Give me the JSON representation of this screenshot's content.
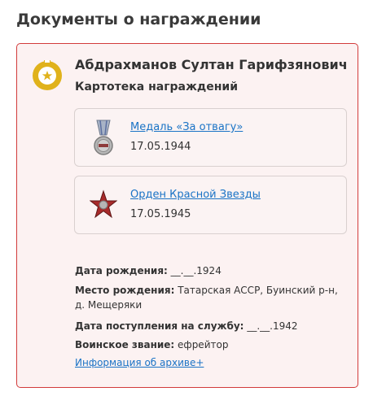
{
  "section": {
    "title": "Документы о награждении"
  },
  "person": {
    "name": "Абдрахманов Султан Гарифзянович",
    "card_subtitle": "Картотека награждений"
  },
  "awards": [
    {
      "name": "Медаль «За отвагу»",
      "date": "17.05.1944",
      "icon": "medal-icon"
    },
    {
      "name": "Орден Красной Звезды",
      "date": "17.05.1945",
      "icon": "red-star-order-icon"
    }
  ],
  "details": {
    "birth_date_label": "Дата рождения:",
    "birth_date_value": "__.__.1924",
    "birth_place_label": "Место рождения:",
    "birth_place_value": "Татарская АССР, Буинский р-н, д. Мещеряки",
    "service_date_label": "Дата поступления на службу:",
    "service_date_value": "__.__.1942",
    "rank_label": "Воинское звание:",
    "rank_value": "ефрейтор"
  },
  "archive_link": "Информация об архиве+",
  "colors": {
    "card_border": "#d23b3b",
    "card_bg": "#fcf2f2",
    "link": "#1a73c6",
    "badge_gold": "#e0b21b"
  }
}
